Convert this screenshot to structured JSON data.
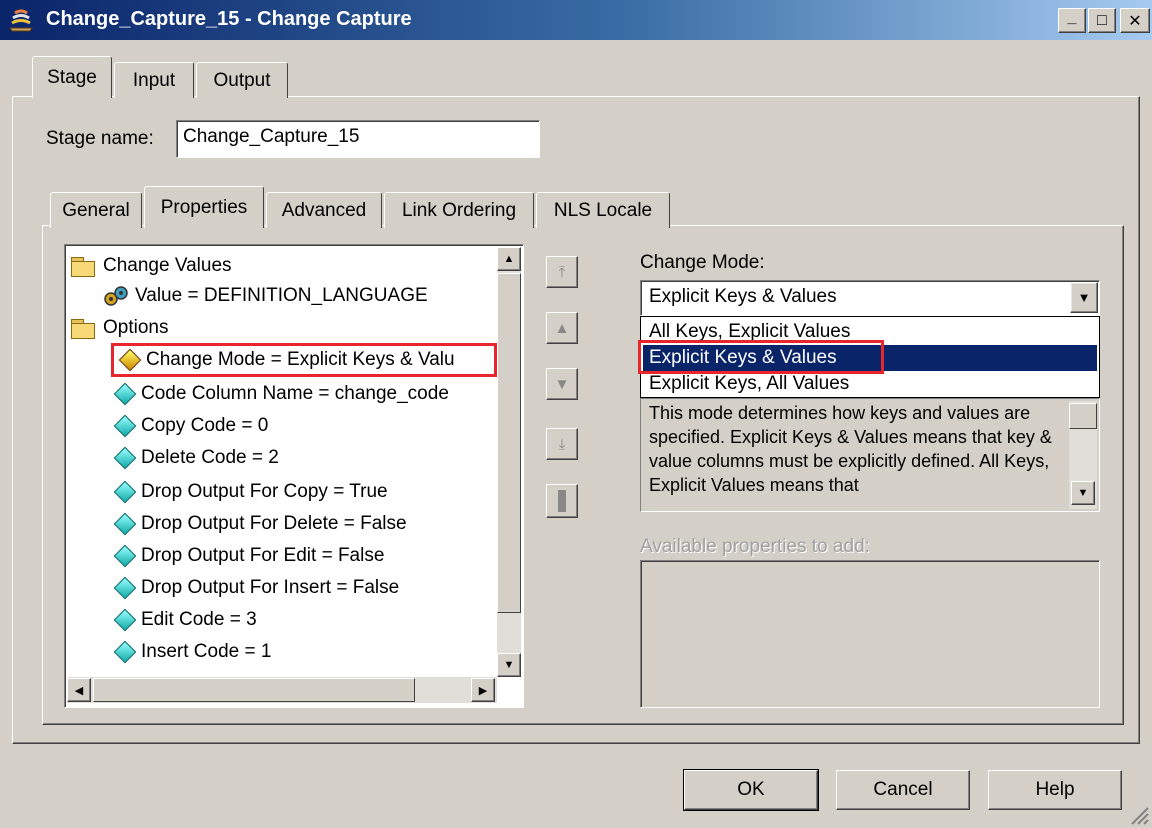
{
  "window": {
    "title": "Change_Capture_15 - Change Capture",
    "minimize": "_",
    "maximize": "□",
    "close": "✕"
  },
  "top_tabs": [
    {
      "label": "Stage"
    },
    {
      "label": "Input"
    },
    {
      "label": "Output"
    }
  ],
  "stage_name": {
    "label": "Stage name:",
    "value": "Change_Capture_15"
  },
  "inner_tabs": [
    {
      "label": "General"
    },
    {
      "label": "Properties"
    },
    {
      "label": "Advanced"
    },
    {
      "label": "Link Ordering"
    },
    {
      "label": "NLS Locale"
    }
  ],
  "tree": {
    "rows": [
      {
        "label": "Change Values"
      },
      {
        "label": "Value = DEFINITION_LANGUAGE"
      },
      {
        "label": "Options"
      },
      {
        "label": "Change Mode = Explicit Keys & Valu"
      },
      {
        "label": "Code Column Name = change_code"
      },
      {
        "label": "Copy Code = 0"
      },
      {
        "label": "Delete Code = 2"
      },
      {
        "label": "Drop Output For Copy = True"
      },
      {
        "label": "Drop Output For Delete = False"
      },
      {
        "label": "Drop Output For Edit = False"
      },
      {
        "label": "Drop Output For Insert = False"
      },
      {
        "label": "Edit Code = 3"
      },
      {
        "label": "Insert Code = 1"
      }
    ]
  },
  "change_mode": {
    "label": "Change Mode:",
    "selected": "Explicit Keys & Values",
    "options": [
      "All Keys, Explicit Values",
      "Explicit Keys & Values",
      "Explicit Keys, All Values"
    ],
    "description": "This mode determines how keys and values are specified. Explicit Keys & Values means that key & value columns must be explicitly defined. All Keys, Explicit Values means that"
  },
  "available": {
    "label": "Available properties to add:"
  },
  "buttons": {
    "ok": "OK",
    "cancel": "Cancel",
    "help": "Help"
  },
  "colors": {
    "selection": "#0a246a",
    "highlight_box": "#e8262c",
    "window_bg": "#d4d0c8"
  }
}
